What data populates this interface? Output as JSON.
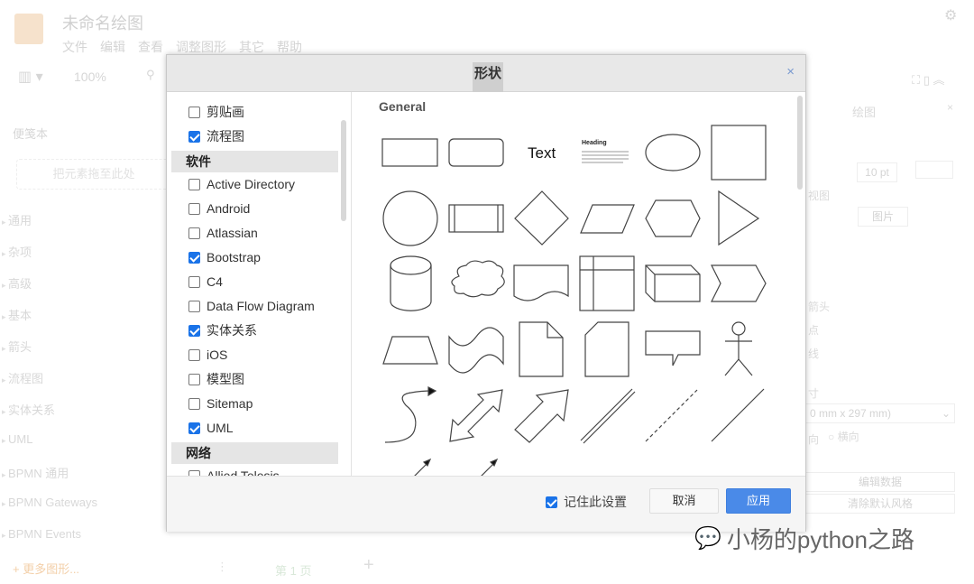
{
  "app": {
    "title": "未命名绘图",
    "menu": [
      "文件",
      "编辑",
      "查看",
      "调整图形",
      "其它",
      "帮助"
    ],
    "zoom": "100%"
  },
  "sidebar": {
    "scratchpad": "便笺本",
    "drop_hint": "把元素拖至此处",
    "items": [
      "通用",
      "杂项",
      "高级",
      "基本",
      "箭头",
      "流程图",
      "实体关系",
      "UML",
      "BPMN 通用",
      "BPMN Gateways",
      "BPMN Events"
    ],
    "more": "+ 更多图形..."
  },
  "right_panel": {
    "tab": "绘图",
    "font_size": "10 pt",
    "view": "视图",
    "image_btn": "图片",
    "arrows": "箭头",
    "connect": "点",
    "lines": "线",
    "size": "寸",
    "paper": "0 mm x 297 mm)",
    "portrait": "向",
    "landscape": "横向",
    "edit_data": "编辑数据",
    "clear_style": "清除默认风格"
  },
  "bottom": {
    "page": "第 1 页",
    "add_page": "+"
  },
  "dialog": {
    "title": "形状",
    "close": "×",
    "libraries": [
      {
        "label": "剪贴画",
        "checked": false
      },
      {
        "label": "流程图",
        "checked": true
      },
      {
        "group": "软件"
      },
      {
        "label": "Active Directory",
        "checked": false
      },
      {
        "label": "Android",
        "checked": false
      },
      {
        "label": "Atlassian",
        "checked": false
      },
      {
        "label": "Bootstrap",
        "checked": true
      },
      {
        "label": "C4",
        "checked": false
      },
      {
        "label": "Data Flow Diagram",
        "checked": false
      },
      {
        "label": "实体关系",
        "checked": true
      },
      {
        "label": "iOS",
        "checked": false
      },
      {
        "label": "模型图",
        "checked": false
      },
      {
        "label": "Sitemap",
        "checked": false
      },
      {
        "label": "UML",
        "checked": true
      },
      {
        "group": "网络"
      },
      {
        "label": "Allied Telesis",
        "checked": false
      }
    ],
    "preview_section": "General",
    "preview_text": "Text",
    "preview_heading": "Heading",
    "remember_label": "记住此设置",
    "remember_checked": true,
    "cancel": "取消",
    "apply": "应用"
  },
  "watermark": "小杨的python之路",
  "colors": {
    "accent": "#4a8ae8",
    "checkbox": "#1a73e8",
    "logo": "#f6e2cc"
  }
}
